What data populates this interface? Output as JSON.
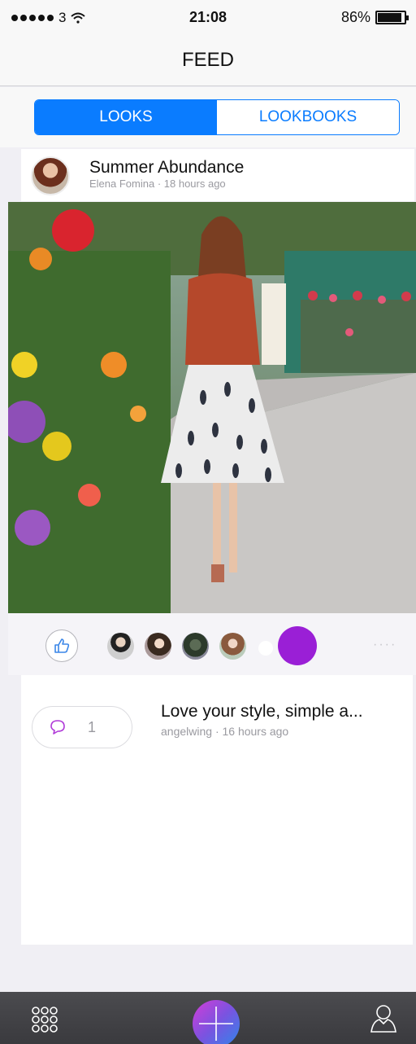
{
  "status_bar": {
    "carrier": "3",
    "time": "21:08",
    "battery_text": "86%",
    "battery_level": 0.86
  },
  "nav": {
    "title": "FEED"
  },
  "segments": {
    "looks": "LOOKS",
    "lookbooks": "LOOKBOOKS"
  },
  "look": {
    "title": "Summer Abundance",
    "meta": "Elena Fomina · 18 hours ago"
  },
  "comments": {
    "count": "1",
    "text": "Love your style, simple a...",
    "meta": "angelwing · 16 hours ago"
  },
  "colors": {
    "accent": "#0a7cff",
    "purple": "#9a1fd6"
  },
  "icons": [
    "wifi-icon",
    "battery-icon",
    "like-icon",
    "comment-icon",
    "grid-icon",
    "add-icon",
    "profile-icon"
  ]
}
